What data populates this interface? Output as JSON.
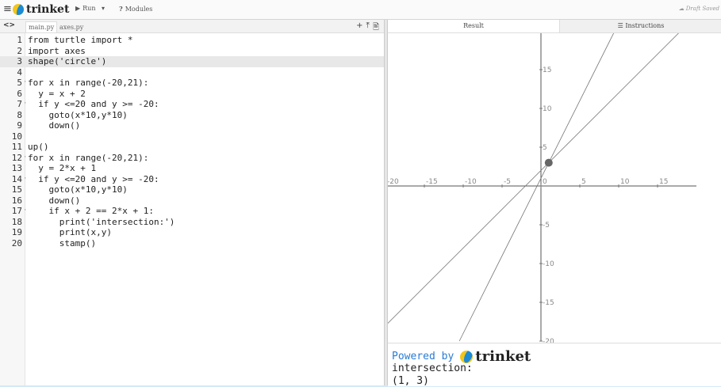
{
  "toolbar": {
    "menu_icon": "≡",
    "brand": "trinket",
    "run_label": "Run",
    "run_dropdown": "▾",
    "modules_label": "Modules",
    "draft_saved": "Draft Saved"
  },
  "editor": {
    "nav": "<>",
    "files": [
      "main.py",
      "axes.py"
    ],
    "tools": [
      "+",
      "⤒",
      "🖹"
    ],
    "lines": [
      {
        "n": "1",
        "text": "from turtle import *"
      },
      {
        "n": "2",
        "text": "import axes"
      },
      {
        "n": "3",
        "text": "shape('circle')"
      },
      {
        "n": "4",
        "text": ""
      },
      {
        "n": "5",
        "text": "for x in range(-20,21):"
      },
      {
        "n": "6",
        "text": "  y = x + 2"
      },
      {
        "n": "7",
        "text": "  if y <=20 and y >= -20:"
      },
      {
        "n": "8",
        "text": "    goto(x*10,y*10)"
      },
      {
        "n": "9",
        "text": "    down()"
      },
      {
        "n": "10",
        "text": ""
      },
      {
        "n": "11",
        "text": "up()"
      },
      {
        "n": "12",
        "text": "for x in range(-20,21):"
      },
      {
        "n": "13",
        "text": "  y = 2*x + 1"
      },
      {
        "n": "14",
        "text": "  if y <=20 and y >= -20:"
      },
      {
        "n": "15",
        "text": "    goto(x*10,y*10)"
      },
      {
        "n": "16",
        "text": "    down()"
      },
      {
        "n": "17",
        "text": "    if x + 2 == 2*x + 1:"
      },
      {
        "n": "18",
        "text": "      print('intersection:')"
      },
      {
        "n": "19",
        "text": "      print(x,y)"
      },
      {
        "n": "20",
        "text": "      stamp()"
      }
    ],
    "highlighted_line": "3",
    "folds": [
      "5",
      "7",
      "12",
      "14",
      "17"
    ]
  },
  "result": {
    "tab_result": "Result",
    "tab_instructions": "Instructions",
    "x_ticks": [
      "-20",
      "-15",
      "-10",
      "-5",
      "0",
      "5",
      "10",
      "15"
    ],
    "y_ticks": [
      "15",
      "10",
      "5",
      "-5",
      "-10",
      "-15",
      "-20"
    ]
  },
  "chart_data": {
    "type": "line",
    "title": "",
    "xlabel": "",
    "ylabel": "",
    "xlim": [
      -20,
      20
    ],
    "ylim": [
      -20,
      20
    ],
    "series": [
      {
        "x": [
          -20,
          18
        ],
        "y": [
          -18,
          20
        ]
      },
      {
        "x": [
          -10.5,
          9.5
        ],
        "y": [
          -20,
          20
        ]
      }
    ],
    "points": [
      {
        "x": 1,
        "y": 3
      }
    ],
    "grid": false
  },
  "console": {
    "powered_by": "Powered by",
    "brand": "trinket",
    "output": [
      "intersection:",
      "(1, 3)"
    ]
  }
}
